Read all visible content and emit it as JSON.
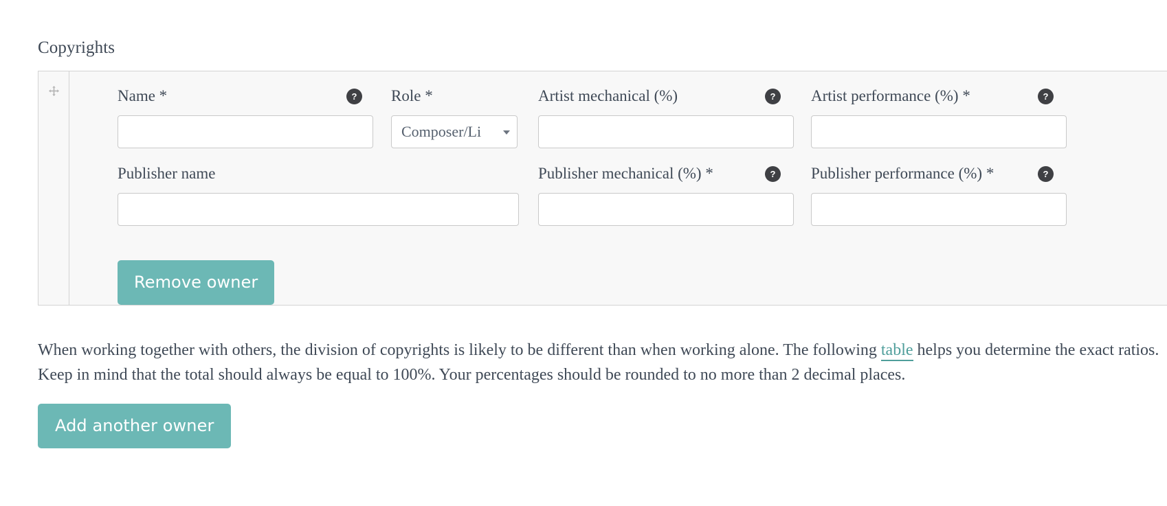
{
  "section": {
    "title": "Copyrights"
  },
  "owner_row": {
    "drag_handle_icon": "move-arrows-icon",
    "fields": {
      "name": {
        "label": "Name *",
        "value": "",
        "placeholder": "",
        "help_icon": "?"
      },
      "role": {
        "label": "Role *",
        "selected": "Composer/Li",
        "options": [
          "Composer/Li"
        ],
        "arrow_icon": "chevron-down-icon"
      },
      "artist_mechanical": {
        "label": "Artist mechanical (%)",
        "value": "",
        "placeholder": "",
        "help_icon": "?"
      },
      "artist_performance": {
        "label": "Artist performance (%) *",
        "value": "",
        "placeholder": "",
        "help_icon": "?"
      },
      "publisher_name": {
        "label": "Publisher name",
        "value": "",
        "placeholder": ""
      },
      "publisher_mechanical": {
        "label": "Publisher mechanical (%) *",
        "value": "",
        "placeholder": "",
        "help_icon": "?"
      },
      "publisher_performance": {
        "label": "Publisher performance (%) *",
        "value": "",
        "placeholder": "",
        "help_icon": "?"
      }
    },
    "remove_button_label": "Remove owner"
  },
  "helper": {
    "text_before_link": "When working together with others, the division of copyrights is likely to be different than when working alone. The following ",
    "link_text": "table",
    "text_after_link": " helps you determine the exact ratios. Keep in mind that the total should always be equal to 100%. Your percentages should be rounded to no more than 2 decimal places."
  },
  "add_button_label": "Add another owner",
  "colors": {
    "accent_teal": "#6cb8b5",
    "link_teal": "#4f9e9b",
    "help_badge": "#3f4044",
    "panel_bg": "#f8f8f8",
    "panel_border": "#d3d3d3",
    "text": "#3f4956"
  }
}
